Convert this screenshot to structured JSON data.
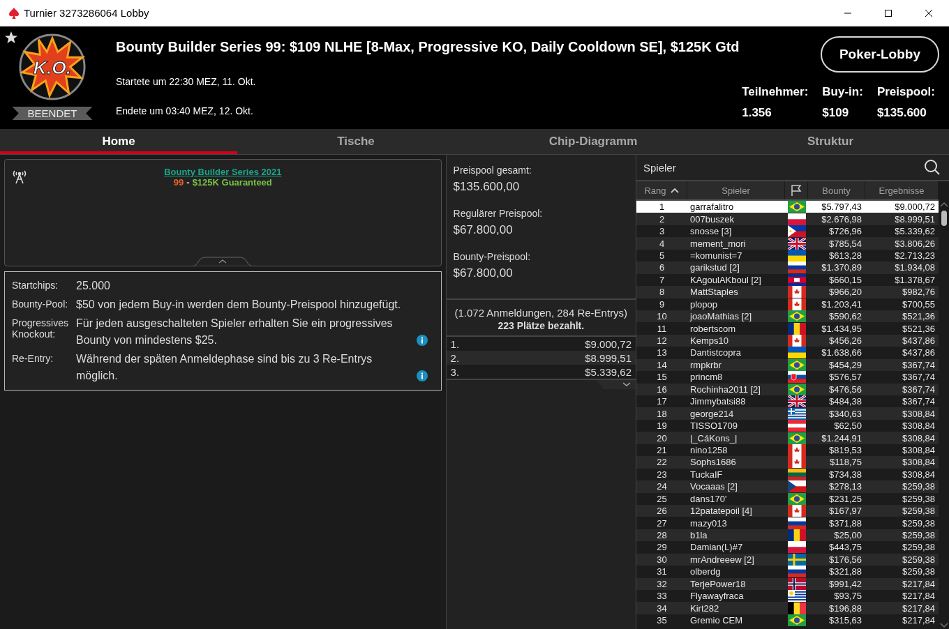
{
  "window": {
    "title": "Turnier 3273286064 Lobby"
  },
  "header": {
    "logo_text": "K.O.",
    "status": "BEENDET",
    "title": "Bounty Builder Series 99: $109 NLHE [8-Max, Progressive KO, Daily Cooldown SE], $125K Gtd",
    "started": "Startete um 22:30 MEZ, 11. Okt.",
    "ended": "Endete um 03:40 MEZ, 12. Okt.",
    "lobby_button": "Poker-Lobby",
    "stats": [
      {
        "label": "Teilnehmer:",
        "value": "1.356"
      },
      {
        "label": "Buy-in:",
        "value": "$109"
      },
      {
        "label": "Preispool:",
        "value": "$135.600"
      }
    ]
  },
  "tabs": [
    {
      "label": "Home",
      "selected": true
    },
    {
      "label": "Tische",
      "selected": false
    },
    {
      "label": "Chip-Diagramm",
      "selected": false
    },
    {
      "label": "Struktur",
      "selected": false
    }
  ],
  "banner": {
    "link": "Bounty Builder Series 2021",
    "subtitle": [
      {
        "text": "99",
        "color": "#e8602c"
      },
      {
        "text": "-",
        "color": "#e0e0e0"
      },
      {
        "text": "$125K Guaranteed",
        "color": "#7ac143"
      }
    ]
  },
  "info": [
    {
      "label": "Startchips:",
      "value": "25.000",
      "info": false
    },
    {
      "label": "Bounty-Pool:",
      "value": "$50 von jedem Buy-in werden dem Bounty-Preispool hinzugefügt.",
      "info": false
    },
    {
      "label": "Progressives Knockout:",
      "value": "Für jeden ausgeschalteten Spieler erhalten Sie ein progressives Bounty von mindestens $25.",
      "info": true
    },
    {
      "label": "Re-Entry:",
      "value": "Während der späten Anmeldephase sind bis zu 3 Re-Entrys möglich.",
      "info": true
    }
  ],
  "prizes": {
    "pools": [
      {
        "label": "Preispool gesamt:",
        "value": "$135.600,00"
      },
      {
        "label": "Regulärer Preispool:",
        "value": "$67.800,00"
      },
      {
        "label": "Bounty-Preispool:",
        "value": "$67.800,00"
      }
    ],
    "entries": "(1.072 Anmeldungen, 284 Re-Entrys)",
    "paid": "223 Plätze bezahlt.",
    "payouts": [
      {
        "place": "1.",
        "amount": "$9.000,72"
      },
      {
        "place": "2.",
        "amount": "$8.999,51"
      },
      {
        "place": "3.",
        "amount": "$5.339,62"
      }
    ]
  },
  "players": {
    "title": "Spieler",
    "columns": [
      {
        "kind": "text",
        "label": "Rang",
        "sorted": true
      },
      {
        "kind": "text",
        "label": "Spieler",
        "sorted": false
      },
      {
        "kind": "flag",
        "sorted": false
      },
      {
        "kind": "text",
        "label": "Bounty",
        "sorted": false
      },
      {
        "kind": "text",
        "label": "Ergebnisse",
        "sorted": false
      }
    ],
    "rows": [
      {
        "rank": "1",
        "name": "garrafalitro",
        "kind": "br",
        "bounty": "$5.797,43",
        "result": "$9.000,72",
        "selected": true
      },
      {
        "rank": "2",
        "name": "007buszek",
        "kind": "pl",
        "bounty": "$2.676,98",
        "result": "$8.999,51",
        "selected": false
      },
      {
        "rank": "3",
        "name": "snosse [3]",
        "kind": "ph",
        "bounty": "$726,96",
        "result": "$5.339,62",
        "selected": false
      },
      {
        "rank": "4",
        "name": "mement_mori",
        "kind": "gb",
        "bounty": "$785,54",
        "result": "$3.806,26",
        "selected": false
      },
      {
        "rank": "5",
        "name": "=komunist=7",
        "kind": "ua",
        "bounty": "$613,28",
        "result": "$2.713,23",
        "selected": false
      },
      {
        "rank": "6",
        "name": "garikstud [2]",
        "kind": "ru",
        "bounty": "$1.370,89",
        "result": "$1.934,08",
        "selected": false
      },
      {
        "rank": "7",
        "name": "KAgoulAKboul [2]",
        "kind": "kh",
        "bounty": "$660,15",
        "result": "$1.378,67",
        "selected": false
      },
      {
        "rank": "8",
        "name": "MattStaples",
        "kind": "ca",
        "bounty": "$966,20",
        "result": "$982,76",
        "selected": false
      },
      {
        "rank": "9",
        "name": "plopop",
        "kind": "ca",
        "bounty": "$1.203,41",
        "result": "$700,55",
        "selected": false
      },
      {
        "rank": "10",
        "name": "joaoMathias [2]",
        "kind": "br",
        "bounty": "$590,62",
        "result": "$521,36",
        "selected": false
      },
      {
        "rank": "11",
        "name": "robertscom",
        "kind": "ro",
        "bounty": "$1.434,95",
        "result": "$521,36",
        "selected": false
      },
      {
        "rank": "12",
        "name": "Kemps10",
        "kind": "ca",
        "bounty": "$456,26",
        "result": "$437,86",
        "selected": false
      },
      {
        "rank": "13",
        "name": "Dantistcopra",
        "kind": "ua",
        "bounty": "$1.638,66",
        "result": "$437,86",
        "selected": false
      },
      {
        "rank": "14",
        "name": "rmpkrbr",
        "kind": "br",
        "bounty": "$454,29",
        "result": "$367,74",
        "selected": false
      },
      {
        "rank": "15",
        "name": "princm8",
        "kind": "sk",
        "bounty": "$576,57",
        "result": "$367,74",
        "selected": false
      },
      {
        "rank": "16",
        "name": "Rochinha2011 [2]",
        "kind": "br",
        "bounty": "$476,56",
        "result": "$367,74",
        "selected": false
      },
      {
        "rank": "17",
        "name": "Jimmybatsi88",
        "kind": "gb",
        "bounty": "$484,38",
        "result": "$367,74",
        "selected": false
      },
      {
        "rank": "18",
        "name": "george214",
        "kind": "gr",
        "bounty": "$340,63",
        "result": "$308,84",
        "selected": false
      },
      {
        "rank": "19",
        "name": "TISSO1709",
        "kind": "at",
        "bounty": "$62,50",
        "result": "$308,84",
        "selected": false
      },
      {
        "rank": "20",
        "name": "|_CáKons_|",
        "kind": "br",
        "bounty": "$1.244,91",
        "result": "$308,84",
        "selected": false
      },
      {
        "rank": "21",
        "name": "nino1258",
        "kind": "ca",
        "bounty": "$819,53",
        "result": "$308,84",
        "selected": false
      },
      {
        "rank": "22",
        "name": "Sophs1686",
        "kind": "ca",
        "bounty": "$118,75",
        "result": "$308,84",
        "selected": false
      },
      {
        "rank": "23",
        "name": "TuckaIF",
        "kind": "lt",
        "bounty": "$734,38",
        "result": "$308,84",
        "selected": false
      },
      {
        "rank": "24",
        "name": "Vocaaas [2]",
        "kind": "cz",
        "bounty": "$278,13",
        "result": "$259,38",
        "selected": false
      },
      {
        "rank": "25",
        "name": "dans170'",
        "kind": "br",
        "bounty": "$231,25",
        "result": "$259,38",
        "selected": false
      },
      {
        "rank": "26",
        "name": "12patatepoil [4]",
        "kind": "ca",
        "bounty": "$167,97",
        "result": "$259,38",
        "selected": false
      },
      {
        "rank": "27",
        "name": "mazy013",
        "kind": "ru",
        "bounty": "$371,88",
        "result": "$259,38",
        "selected": false
      },
      {
        "rank": "28",
        "name": "b1la",
        "kind": "ro",
        "bounty": "$25,00",
        "result": "$259,38",
        "selected": false
      },
      {
        "rank": "29",
        "name": "Damian(L)#7",
        "kind": "pl",
        "bounty": "$443,75",
        "result": "$259,38",
        "selected": false
      },
      {
        "rank": "30",
        "name": "mrAndreeew [2]",
        "kind": "se",
        "bounty": "$176,56",
        "result": "$259,38",
        "selected": false
      },
      {
        "rank": "31",
        "name": "olberdg",
        "kind": "ru",
        "bounty": "$321,88",
        "result": "$259,38",
        "selected": false
      },
      {
        "rank": "32",
        "name": "TerjePower18",
        "kind": "no",
        "bounty": "$991,42",
        "result": "$217,84",
        "selected": false
      },
      {
        "rank": "33",
        "name": "Flyawayfraca",
        "kind": "uy",
        "bounty": "$93,75",
        "result": "$217,84",
        "selected": false
      },
      {
        "rank": "34",
        "name": "Kirt282",
        "kind": "be",
        "bounty": "$196,88",
        "result": "$217,84",
        "selected": false
      },
      {
        "rank": "35",
        "name": "Gremio CEM",
        "kind": "br",
        "bounty": "$315,63",
        "result": "$217,84",
        "selected": false
      }
    ]
  }
}
